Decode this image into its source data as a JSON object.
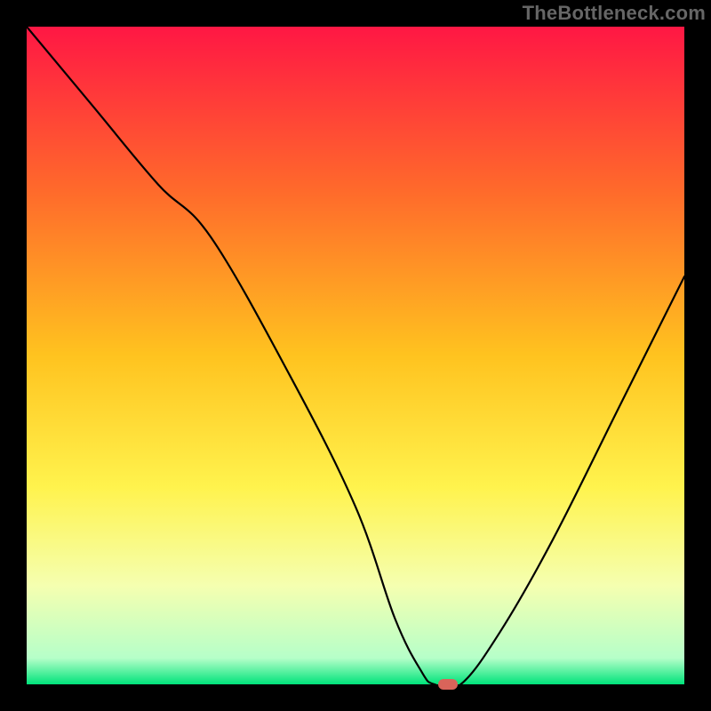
{
  "watermark": "TheBottleneck.com",
  "chart_data": {
    "type": "line",
    "title": "",
    "xlabel": "",
    "ylabel": "",
    "xlim": [
      0,
      100
    ],
    "ylim": [
      0,
      100
    ],
    "gradient_stops": [
      {
        "offset": 0,
        "color": "#ff1744"
      },
      {
        "offset": 25,
        "color": "#ff6a2b"
      },
      {
        "offset": 50,
        "color": "#ffc31f"
      },
      {
        "offset": 70,
        "color": "#fff34d"
      },
      {
        "offset": 85,
        "color": "#f5ffb0"
      },
      {
        "offset": 96,
        "color": "#b6ffc9"
      },
      {
        "offset": 100,
        "color": "#00e37a"
      }
    ],
    "series": [
      {
        "name": "bottleneck-curve",
        "x": [
          0,
          10,
          20,
          28,
          40,
          50,
          56,
          60,
          62,
          66,
          72,
          80,
          90,
          100
        ],
        "y": [
          100,
          88,
          76,
          68,
          47,
          27,
          10,
          2,
          0,
          0,
          8,
          22,
          42,
          62
        ]
      }
    ],
    "marker": {
      "x": 64,
      "y": 0,
      "width_pct": 3.0,
      "height_pct": 1.6
    }
  }
}
